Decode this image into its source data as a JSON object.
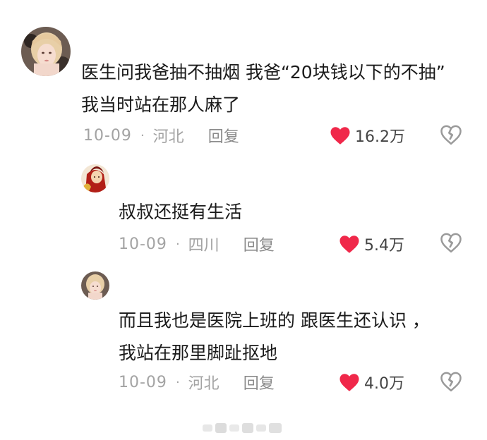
{
  "colors": {
    "like_heart": "#f0284a",
    "meta_text": "#a3a3a3",
    "body_text": "#1a1a1a",
    "dislike_outline": "#9a9a9a"
  },
  "comments": [
    {
      "text": "医生问我爸抽不抽烟 我爸“20块钱以下的不抽” 我当时站在那人麻了",
      "date": "10-09",
      "separator": "·",
      "location": "河北",
      "reply_label": "回复",
      "likes": "16.2万",
      "avatar": "avatar-blonde-woman",
      "like_icon": "heart-icon",
      "dislike_icon": "broken-heart-icon"
    },
    {
      "text": "叔叔还挺有生活",
      "date": "10-09",
      "separator": "·",
      "location": "四川",
      "reply_label": "回复",
      "likes": "5.4万",
      "avatar": "avatar-red-character",
      "like_icon": "heart-icon",
      "dislike_icon": "broken-heart-icon"
    },
    {
      "text": "而且我也是医院上班的 跟医生还认识 ，我站在那里脚趾抠地",
      "date": "10-09",
      "separator": "·",
      "location": "河北",
      "reply_label": "回复",
      "likes": "4.0万",
      "avatar": "avatar-blonde-woman",
      "like_icon": "heart-icon",
      "dislike_icon": "broken-heart-icon"
    }
  ]
}
